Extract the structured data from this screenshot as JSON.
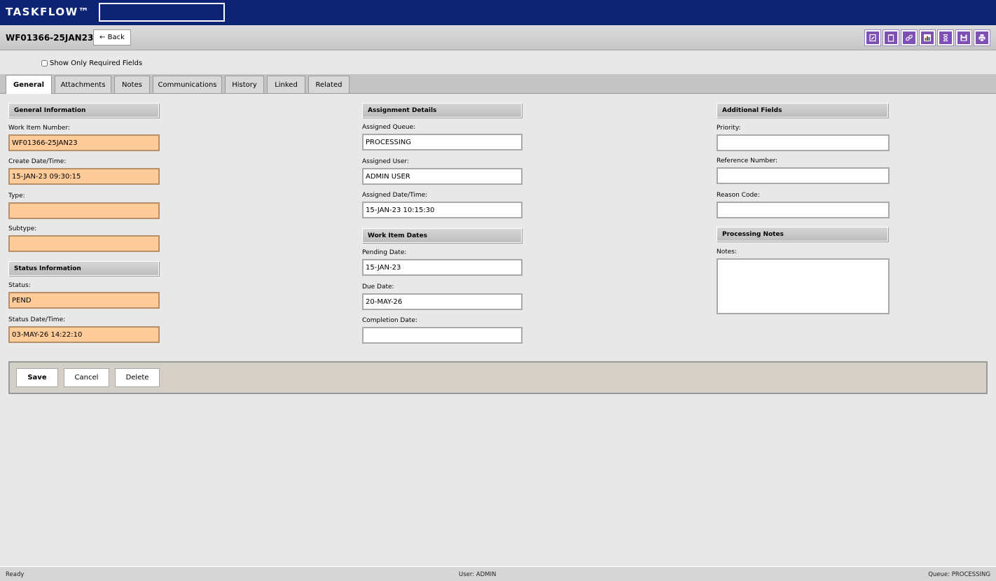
{
  "app": {
    "brand": "TASKFLOW™",
    "search_placeholder": ""
  },
  "record": {
    "id": "WF01366-25JAN23",
    "back_label": "← Back"
  },
  "toolbar": {
    "icons": [
      "edit-icon",
      "clipboard-icon",
      "link-icon",
      "chart-icon",
      "hourglass-icon",
      "save-icon",
      "print-icon"
    ]
  },
  "options": {
    "required_only_label": "Show Only Required Fields",
    "required_only_checked": false
  },
  "tabs": [
    {
      "label": "General",
      "active": true
    },
    {
      "label": "Attachments",
      "active": false
    },
    {
      "label": "Notes",
      "active": false
    },
    {
      "label": "Communications",
      "active": false
    },
    {
      "label": "History",
      "active": false
    },
    {
      "label": "Linked",
      "active": false
    },
    {
      "label": "Related",
      "active": false
    }
  ],
  "general": {
    "heading": "General Information",
    "work_item_number_label": "Work Item Number:",
    "work_item_number": "WF01366-25JAN23",
    "create_datetime_label": "Create Date/Time:",
    "create_datetime": "15-JAN-23 09:30:15",
    "type_label": "Type:",
    "type": "",
    "subtype_label": "Subtype:",
    "subtype": ""
  },
  "status": {
    "heading": "Status Information",
    "status_label": "Status:",
    "status": "PEND",
    "status_datetime_label": "Status Date/Time:",
    "status_datetime": "03-MAY-26 14:22:10"
  },
  "assignment": {
    "heading": "Assignment Details",
    "queue_label": "Assigned Queue:",
    "queue": "PROCESSING",
    "user_label": "Assigned User:",
    "user": "ADMIN USER",
    "datetime_label": "Assigned Date/Time:",
    "datetime": "15-JAN-23 10:15:30"
  },
  "dates": {
    "heading": "Work Item Dates",
    "pending_label": "Pending Date:",
    "pending": "15-JAN-23",
    "due_label": "Due Date:",
    "due": "20-MAY-26",
    "completion_label": "Completion Date:",
    "completion": ""
  },
  "additional": {
    "heading": "Additional Fields",
    "priority_label": "Priority:",
    "priority": "",
    "reference_label": "Reference Number:",
    "reference": "",
    "reason_label": "Reason Code:",
    "reason": ""
  },
  "processing_notes": {
    "heading": "Processing Notes",
    "notes_label": "Notes:",
    "notes": ""
  },
  "actions": {
    "save": "Save",
    "cancel": "Cancel",
    "delete": "Delete"
  },
  "statusbar": {
    "state": "Ready",
    "user": "User: ADMIN",
    "queue": "Queue: PROCESSING"
  },
  "colors": {
    "brand_bar": "#0d2475",
    "required_field": "#ffcc99",
    "toolbar_icon": "#7e4fb5"
  }
}
